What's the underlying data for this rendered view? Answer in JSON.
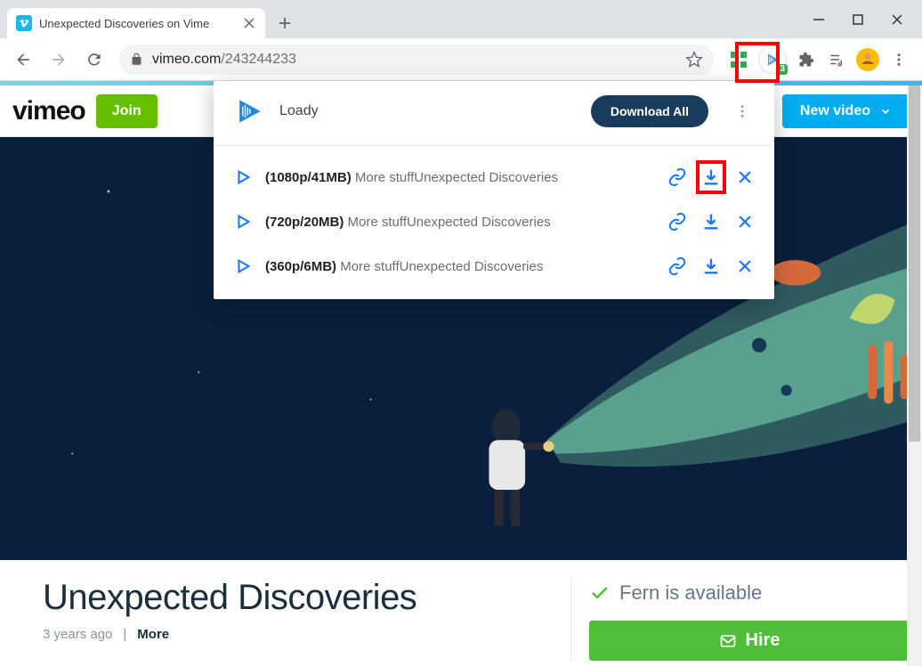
{
  "browser": {
    "tab_title": "Unexpected Discoveries on Vime",
    "url_host": "vimeo.com",
    "url_path": "/243244233",
    "loady_badge": "3"
  },
  "site": {
    "logo_text": "vimeo",
    "join_label": "Join",
    "new_video_label": "New video"
  },
  "popup": {
    "title": "Loady",
    "download_all_label": "Download All",
    "items": [
      {
        "quality": "(1080p/41MB)",
        "desc": "More stuffUnexpected Discoveries"
      },
      {
        "quality": "(720p/20MB)",
        "desc": "More stuffUnexpected Discoveries"
      },
      {
        "quality": "(360p/6MB)",
        "desc": "More stuffUnexpected Discoveries"
      }
    ]
  },
  "video": {
    "title": "Unexpected Discoveries",
    "age": "3 years ago",
    "more_label": "More"
  },
  "side": {
    "availability": "Fern is available",
    "hire_label": "Hire"
  }
}
